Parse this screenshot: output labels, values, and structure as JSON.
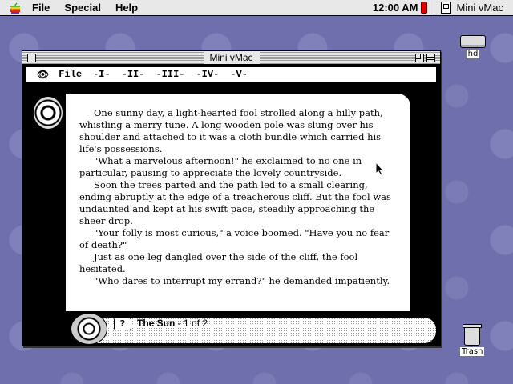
{
  "menubar": {
    "apple_icon": "apple-icon",
    "items": [
      "File",
      "Special",
      "Help"
    ],
    "clock": "12:00 AM",
    "app_name": "Mini vMac"
  },
  "desktop": {
    "hd_label": "hd",
    "trash_label": "Trash"
  },
  "window": {
    "title": "Mini vMac",
    "app_menu": [
      "File",
      "-I-",
      "-II-",
      "-III-",
      "-IV-",
      "-V-"
    ]
  },
  "story": {
    "paragraphs": [
      "One sunny day, a light-hearted fool strolled along a hilly path, whistling a merry tune. A long wooden pole was slung over his shoulder and attached to it was a cloth bundle which carried his life's possessions.",
      "\"What a marvelous afternoon!\" he exclaimed to no one in particular, pausing to appreciate the lovely countryside.",
      "Soon the trees parted and the path led to a small clearing, ending abruptly at the edge of a treacherous cliff. But the fool was undaunted and kept at his swift pace, steadily approaching the sheer drop.",
      "\"Your folly is most curious,\" a voice boomed. \"Have you no fear of death?\"",
      "Just as one leg dangled over the side of the cliff, the fool hesitated.",
      "\"Who dares to interrupt my errand?\" he demanded impatiently."
    ]
  },
  "footer": {
    "help": "?",
    "card_title": "The Sun",
    "page_info": " - 1 of 2"
  },
  "colors": {
    "desktop": "#6f6fae",
    "battery": "#dd0000"
  }
}
